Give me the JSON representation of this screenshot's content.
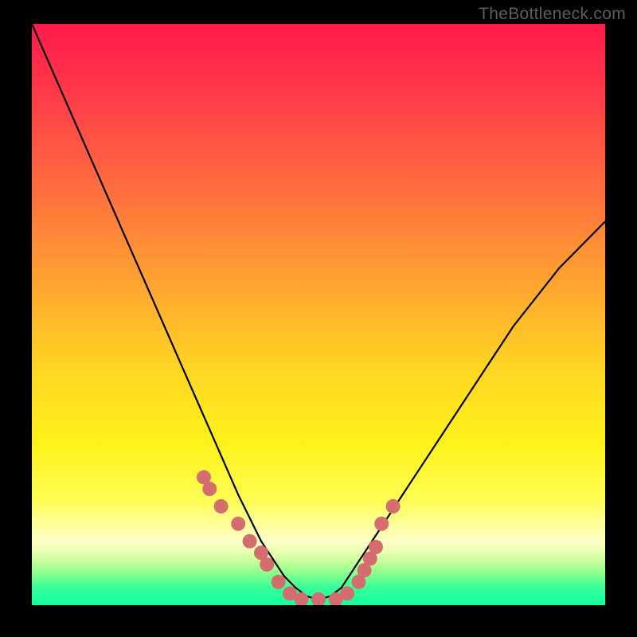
{
  "watermark": "TheBottleneck.com",
  "chart_data": {
    "type": "line",
    "title": "",
    "xlabel": "",
    "ylabel": "",
    "xlim": [
      0,
      100
    ],
    "ylim": [
      0,
      100
    ],
    "series": [
      {
        "name": "bottleneck-curve",
        "x": [
          0,
          4,
          8,
          12,
          16,
          20,
          24,
          28,
          32,
          36,
          40,
          42,
          44,
          46,
          48,
          50,
          52,
          54,
          56,
          60,
          64,
          68,
          72,
          76,
          80,
          84,
          88,
          92,
          96,
          100
        ],
        "values": [
          100,
          91,
          82,
          73,
          64,
          55,
          46,
          37,
          28,
          19,
          11,
          8,
          5,
          3,
          1.5,
          1.0,
          1.5,
          3,
          6,
          12,
          18,
          24,
          30,
          36,
          42,
          48,
          53,
          58,
          62,
          66
        ]
      }
    ],
    "markers": {
      "name": "highlight-points",
      "color": "#d46d6d",
      "x": [
        30,
        31,
        33,
        36,
        38,
        40,
        41,
        43,
        45,
        47,
        50,
        53,
        55,
        57,
        58,
        59,
        60,
        61,
        63
      ],
      "values": [
        22,
        20,
        17,
        14,
        11,
        9,
        7,
        4,
        2,
        1,
        1,
        1,
        2,
        4,
        6,
        8,
        10,
        14,
        17
      ]
    }
  }
}
